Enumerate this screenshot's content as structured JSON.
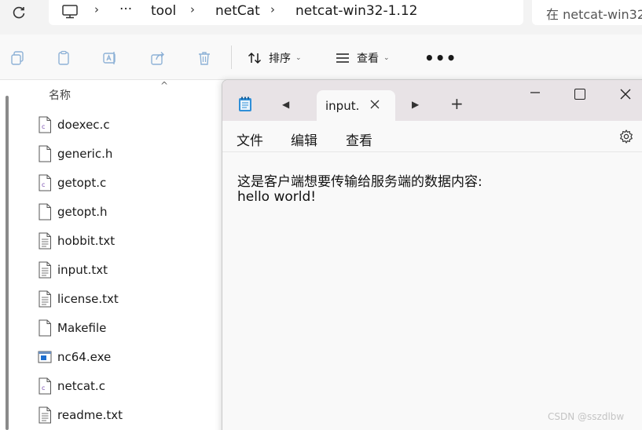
{
  "address": {
    "segments": [
      "tool",
      "netCat",
      "netcat-win32-1.12"
    ],
    "overflow": "···",
    "search_placeholder": "在 netcat-win32"
  },
  "toolbar": {
    "sort_label": "排序",
    "view_label": "查看",
    "more_label": "•••"
  },
  "filelist": {
    "column_name": "名称",
    "files": [
      {
        "name": "doexec.c",
        "icon": "c-source-file-icon"
      },
      {
        "name": "generic.h",
        "icon": "blank-file-icon"
      },
      {
        "name": "getopt.c",
        "icon": "c-source-file-icon"
      },
      {
        "name": "getopt.h",
        "icon": "blank-file-icon"
      },
      {
        "name": "hobbit.txt",
        "icon": "text-file-icon"
      },
      {
        "name": "input.txt",
        "icon": "text-file-icon"
      },
      {
        "name": "license.txt",
        "icon": "text-file-icon"
      },
      {
        "name": "Makefile",
        "icon": "blank-file-icon"
      },
      {
        "name": "nc64.exe",
        "icon": "executable-file-icon"
      },
      {
        "name": "netcat.c",
        "icon": "c-source-file-icon"
      },
      {
        "name": "readme.txt",
        "icon": "text-file-icon"
      }
    ]
  },
  "notepad": {
    "tab_title": "input.",
    "menu": [
      "文件",
      "编辑",
      "查看"
    ],
    "content_lines": [
      "这是客户端想要传输给服务端的数据内容:",
      "hello world!"
    ]
  },
  "watermark": "CSDN @sszdlbw"
}
